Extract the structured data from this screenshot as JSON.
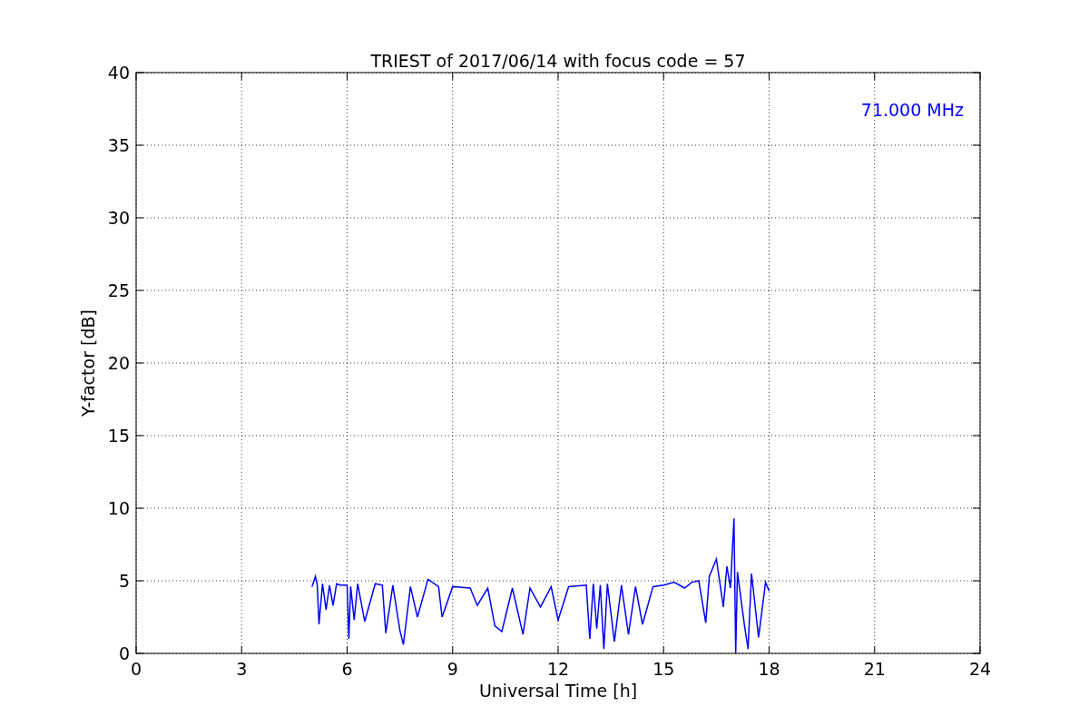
{
  "figure": {
    "chart_data": {
      "type": "line",
      "title": "TRIEST of 2017/06/14 with focus code = 57",
      "xlabel": "Universal Time [h]",
      "ylabel": "Y-factor [dB]",
      "xlim": [
        0,
        24
      ],
      "ylim": [
        0,
        40
      ],
      "xticks": [
        0,
        3,
        6,
        9,
        12,
        15,
        18,
        21,
        24
      ],
      "yticks": [
        0,
        5,
        10,
        15,
        20,
        25,
        30,
        35,
        40
      ],
      "x": [
        5.0,
        5.1,
        5.15,
        5.2,
        5.3,
        5.4,
        5.5,
        5.6,
        5.7,
        5.8,
        6.0,
        6.05,
        6.1,
        6.2,
        6.3,
        6.5,
        6.8,
        7.0,
        7.1,
        7.3,
        7.5,
        7.6,
        7.8,
        8.0,
        8.3,
        8.6,
        8.7,
        9.0,
        9.5,
        9.7,
        10.0,
        10.2,
        10.4,
        10.7,
        11.0,
        11.2,
        11.5,
        11.8,
        12.0,
        12.3,
        12.8,
        12.9,
        13.0,
        13.1,
        13.2,
        13.3,
        13.4,
        13.6,
        13.8,
        14.0,
        14.2,
        14.4,
        14.7,
        15.0,
        15.3,
        15.6,
        15.8,
        16.0,
        16.2,
        16.3,
        16.5,
        16.7,
        16.8,
        16.9,
        17.0,
        17.05,
        17.1,
        17.3,
        17.4,
        17.5,
        17.7,
        17.9,
        18.0
      ],
      "series": [
        {
          "name": "71.000 MHz",
          "color": "#0000ff",
          "values": [
            4.6,
            5.3,
            4.7,
            2.0,
            4.8,
            3.0,
            4.7,
            3.3,
            4.8,
            4.7,
            4.7,
            1.0,
            4.6,
            2.3,
            4.8,
            2.2,
            4.8,
            4.7,
            1.4,
            4.7,
            1.6,
            0.6,
            4.6,
            2.5,
            5.1,
            4.6,
            2.5,
            4.6,
            4.5,
            3.3,
            4.5,
            1.9,
            1.5,
            4.5,
            1.3,
            4.5,
            3.2,
            4.6,
            2.3,
            4.6,
            4.7,
            1.0,
            4.8,
            1.7,
            4.7,
            0.3,
            4.8,
            0.8,
            4.7,
            1.3,
            4.6,
            2.0,
            4.6,
            4.7,
            4.9,
            4.5,
            4.9,
            5.0,
            2.1,
            5.3,
            6.5,
            3.2,
            6.0,
            4.5,
            9.3,
            0.0,
            5.6,
            1.9,
            0.3,
            5.5,
            1.1,
            4.9,
            4.3
          ]
        }
      ],
      "grid": true
    }
  }
}
